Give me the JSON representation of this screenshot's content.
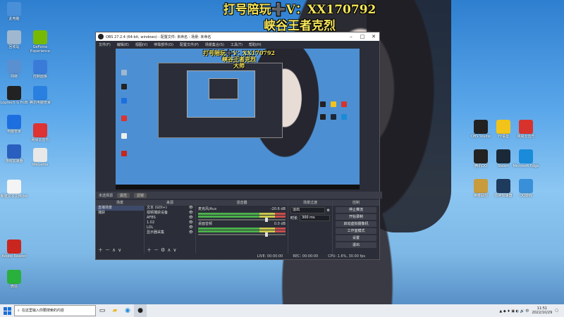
{
  "overlay": {
    "line1": "打号陪玩➕V：XX170792",
    "line2": "峡谷王者克烈",
    "line3": "大师"
  },
  "desktop_icons_left": [
    {
      "label": "此电脑",
      "icon": "computer-icon",
      "color": "#4a90d9"
    },
    {
      "label": "回收站",
      "icon": "recycle-bin-icon",
      "color": "#9fb8d0"
    },
    {
      "label": "GeForce Experience",
      "icon": "nvidia-icon",
      "color": "#76b900"
    },
    {
      "label": "网络",
      "icon": "network-icon",
      "color": "#5a8fd0"
    },
    {
      "label": "控制面板",
      "icon": "control-panel-icon",
      "color": "#3b7bd8"
    },
    {
      "label": "Logitech G HUB",
      "icon": "logitech-icon",
      "color": "#222"
    },
    {
      "label": "腾讯电脑管家",
      "icon": "tencent-pc-icon",
      "color": "#2a80e0"
    },
    {
      "label": "电脑管家",
      "icon": "shield-icon",
      "color": "#1d6fe0"
    },
    {
      "label": "网易云音乐",
      "icon": "music-icon",
      "color": "#d33"
    },
    {
      "label": "游戏加速器",
      "icon": "game-icon",
      "color": "#2b5fbf"
    },
    {
      "label": "WeGame",
      "icon": "wegame-icon",
      "color": "#e8e8e8"
    },
    {
      "label": "新建文本文档.txt",
      "icon": "text-file-icon",
      "color": "#f4f4f4"
    },
    {
      "label": "Adobe Reader",
      "icon": "pdf-icon",
      "color": "#c8261f"
    },
    {
      "label": "微信",
      "icon": "wechat-icon",
      "color": "#2ab03c"
    }
  ],
  "desktop_icons_right": [
    {
      "label": "OBS Studio",
      "icon": "obs-icon",
      "color": "#222"
    },
    {
      "label": "YY语音",
      "icon": "yy-icon",
      "color": "#f2c318"
    },
    {
      "label": "网易云音乐",
      "icon": "netease-icon",
      "color": "#d8322d"
    },
    {
      "label": "腾讯QQ",
      "icon": "qq-icon",
      "color": "#222"
    },
    {
      "label": "Steam",
      "icon": "steam-icon",
      "color": "#1b2838"
    },
    {
      "label": "Microsoft Edge",
      "icon": "edge-icon",
      "color": "#1a8bd8"
    },
    {
      "label": "英雄联盟",
      "icon": "lol-icon",
      "color": "#c89b3c"
    },
    {
      "label": "雷神加速器",
      "icon": "accelerator-icon",
      "color": "#1e3a5c"
    },
    {
      "label": "QQ游戏",
      "icon": "qq-game-icon",
      "color": "#3a8fd9"
    }
  ],
  "obs": {
    "title": "OBS 27.2.4 (64-bit, windows) - 配置文件: 未命名 - 场景: 未命名",
    "menu": [
      "文件(F)",
      "编辑(E)",
      "视图(V)",
      "停靠部件(D)",
      "配置文件(P)",
      "场景集合(S)",
      "工具(T)",
      "帮助(H)"
    ],
    "source_bar": {
      "label": "未选择源",
      "props": "属性",
      "filters": "滤镜"
    },
    "scenes": {
      "header": "场景",
      "items": [
        "直播场景",
        "捕获"
      ]
    },
    "sources": {
      "header": "来源",
      "items": [
        "文本 (GDI+)",
        "视频捕获设备",
        "AFBS",
        "1.02",
        "LOL",
        "显示器采集"
      ]
    },
    "mixer": {
      "header": "混音器",
      "channels": [
        {
          "name": "麦克风/Aux",
          "db": "-20.6 dB"
        },
        {
          "name": "桌面音频",
          "db": "0.0 dB"
        }
      ]
    },
    "transition": {
      "header": "场景过渡",
      "type": "淡出",
      "duration_label": "时长",
      "duration": "300 ms"
    },
    "controls": {
      "header": "控制",
      "buttons": [
        "停止推流",
        "开始录制",
        "启动虚拟摄像机",
        "工作室模式",
        "设置",
        "退出"
      ]
    },
    "status": {
      "live": "LIVE: 00:00:00",
      "rec": "REC: 00:00:00",
      "cpu": "CPU: 1.6%, 30.00 fps"
    }
  },
  "taskbar": {
    "search_placeholder": "在这里输入你要搜索的内容",
    "time": "11:51",
    "date": "2022/10/29"
  }
}
